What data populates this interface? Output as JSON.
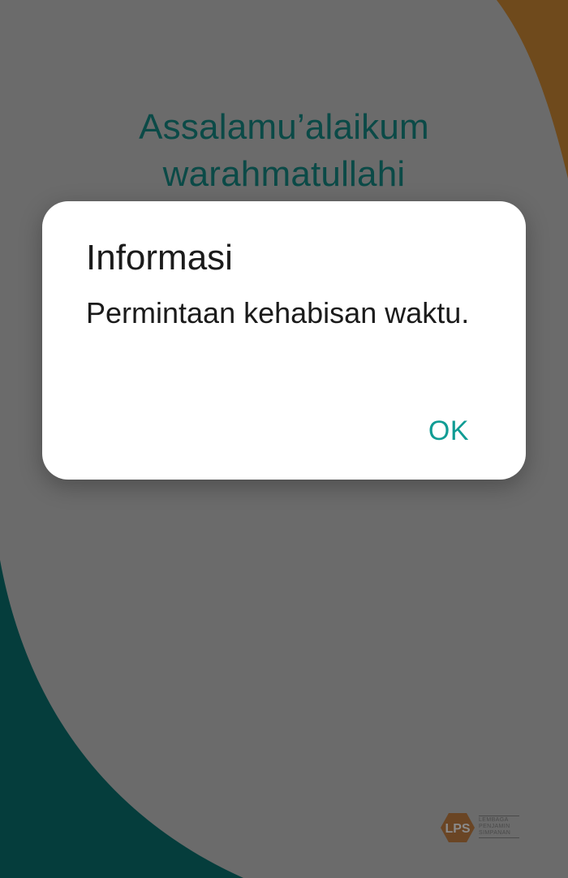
{
  "greeting": {
    "line1": "Assalamu’alaikum",
    "line2": "warahmatullahi"
  },
  "dialog": {
    "title": "Informasi",
    "message": "Permintaan kehabisan waktu.",
    "ok_label": "OK"
  },
  "logo": {
    "mark_letters": "LPS",
    "line1": "LEMBAGA",
    "line2": "PENJAMIN",
    "line3": "SIMPANAN"
  },
  "colors": {
    "overlay_gray": "#6b6b6b",
    "accent_teal": "#109c94",
    "brand_teal_dark": "#0b4a47",
    "brand_gold": "#6f4a1c",
    "dialog_bg": "#ffffff"
  }
}
